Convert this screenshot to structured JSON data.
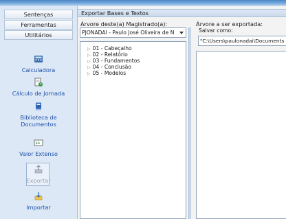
{
  "nav": {
    "tabs": [
      "Sentenças",
      "Ferramentas",
      "Utilitários"
    ],
    "tools": [
      {
        "label": "Calculadora",
        "icon": "calculator-icon",
        "enabled": true
      },
      {
        "label": "Cálculo de Jornada",
        "icon": "clock-document-icon",
        "enabled": true
      },
      {
        "label": "Biblioteca de Documentos",
        "icon": "book-icon",
        "enabled": true
      },
      {
        "label": "Valor Extenso",
        "icon": "number-words-icon",
        "enabled": true
      },
      {
        "label": "Exportar",
        "icon": "export-icon",
        "enabled": false
      },
      {
        "label": "Importar",
        "icon": "import-icon",
        "enabled": true
      }
    ]
  },
  "panel": {
    "title": "Exportar Bases e Textos",
    "left_label": "Árvore deste(a) Magistrado(a):",
    "magistrate_select": "PJONADAI - Paulo José Oliveira de N",
    "tree": [
      "01 - Cabeçalho",
      "02 - Relatório",
      "03 - Fundamentos",
      "04 - Conclusão",
      "05 - Modelos"
    ],
    "right_label": "Árvore a ser exportada:",
    "save_as_label": "Salvar como:",
    "save_path": "\"C:\\Users\\paulonadai\\Documents"
  },
  "colors": {
    "nav_bg": "#dce8f6",
    "link_blue": "#1f4fa8",
    "disabled_gray": "#9aa6b4"
  }
}
